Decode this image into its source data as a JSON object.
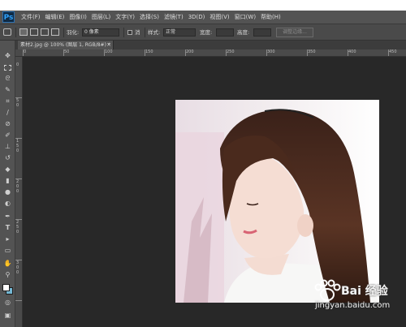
{
  "app": {
    "logo": "Ps"
  },
  "menu": [
    "文件(F)",
    "编辑(E)",
    "图像(I)",
    "图层(L)",
    "文字(Y)",
    "选择(S)",
    "滤镜(T)",
    "3D(D)",
    "视图(V)",
    "窗口(W)",
    "帮助(H)"
  ],
  "options": {
    "feather_label": "羽化:",
    "feather_value": "0 像素",
    "style_label": "样式:",
    "style_value": "正常",
    "antialias_label": "消",
    "width_label": "宽度:",
    "height_label": "高度:",
    "refine_edge_label": "调整边缘..."
  },
  "document": {
    "tab_title": "素材2.jpg @ 100% (图层 1, RGB/8#) *",
    "close_glyph": "×"
  },
  "rulers": {
    "top": [
      "0",
      "50",
      "100",
      "150",
      "200",
      "250",
      "300",
      "350",
      "400",
      "450"
    ],
    "left": [
      "0",
      "5",
      "0",
      "1",
      "5",
      "0",
      "2",
      "0",
      "0",
      "2",
      "5",
      "0",
      "3",
      "0",
      "0"
    ]
  },
  "toolbar": {
    "tools": [
      "move-tool",
      "marquee-tool",
      "lasso-tool",
      "quick-select-tool",
      "crop-tool",
      "eyedropper-tool",
      "healing-tool",
      "brush-tool",
      "stamp-tool",
      "history-brush-tool",
      "eraser-tool",
      "gradient-tool",
      "blur-tool",
      "dodge-tool",
      "pen-tool",
      "type-tool",
      "path-select-tool",
      "shape-tool",
      "hand-tool",
      "zoom-tool"
    ],
    "foreground_color": "#ffffff",
    "background_color": "#74b7d3"
  },
  "watermark": {
    "brand": "Bai 经验",
    "url": "jingyan.baidu.com"
  }
}
